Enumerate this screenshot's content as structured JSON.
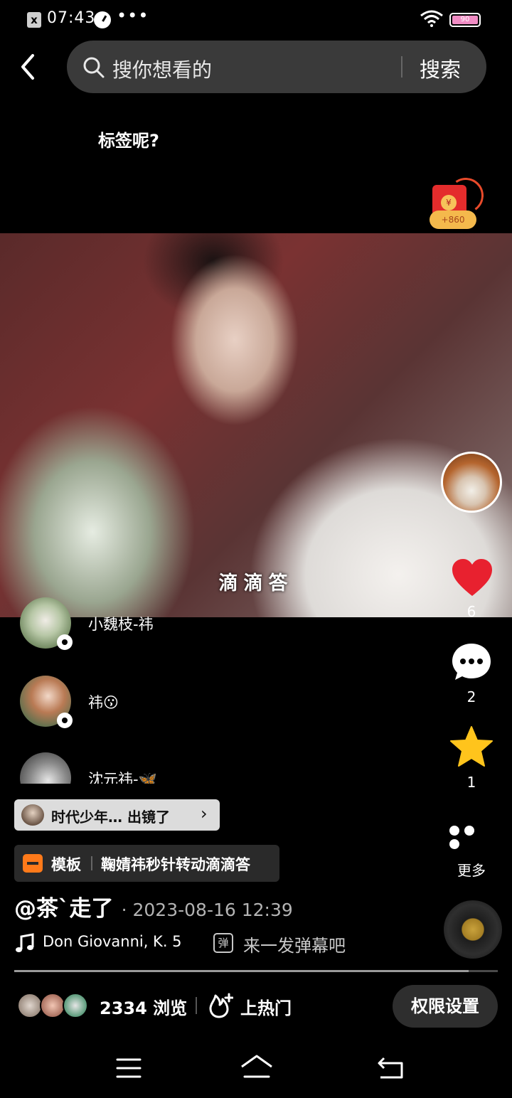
{
  "status_bar": {
    "time": "07:43",
    "dots": "•••",
    "battery": "90"
  },
  "search": {
    "placeholder": "搜你想看的",
    "button": "搜索"
  },
  "caption": "标签呢?",
  "red_packet": {
    "amount": "+860",
    "symbol": "¥"
  },
  "video": {
    "subtitle": "滴滴答"
  },
  "actions": {
    "like_count": "6",
    "comment_count": "2",
    "favorite_count": "1",
    "more_label": "更多"
  },
  "viewers": [
    {
      "name": "小魏枝-祎"
    },
    {
      "name": "祎😗"
    },
    {
      "name": "沈元祎-🦋"
    }
  ],
  "topic": {
    "text": "时代少年… 出镜了",
    "arrow": "›"
  },
  "template": {
    "label": "模板",
    "name": "鞠婧祎秒针转动滴滴答"
  },
  "post": {
    "author": "@茶`走了",
    "date": "· 2023-08-16 12:39"
  },
  "music": {
    "title": "Don Giovanni, K. 5"
  },
  "danmaku": {
    "icon_text": "弹",
    "placeholder": "来一发弹幕吧"
  },
  "progress": {
    "fraction": 0.94
  },
  "bottom_bar": {
    "view_count": "2334 浏览",
    "hot_label": "上热门",
    "permission_label": "权限设置"
  },
  "icons": {
    "back": "back-arrow-icon",
    "search": "search-icon",
    "like": "heart-icon",
    "comment": "comment-icon",
    "favorite": "star-icon",
    "more": "more-icon",
    "music": "music-note-icon",
    "danmaku": "danmaku-icon",
    "hot": "fire-icon"
  },
  "colors": {
    "background": "#000000",
    "like": "#e8212f",
    "favorite": "#ffc41c",
    "template_icon": "#ff7a1a",
    "search_bar": "#3a3a3a"
  }
}
